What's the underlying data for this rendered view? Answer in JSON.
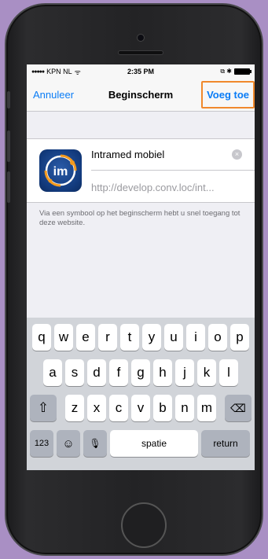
{
  "status": {
    "signal": "●●●●●",
    "carrier": "KPN NL",
    "wifi": "ᯤ",
    "time": "2:35 PM",
    "right_icons": "⧉ ✱"
  },
  "navbar": {
    "cancel_label": "Annuleer",
    "title": "Beginscherm",
    "add_label": "Voeg toe"
  },
  "bookmark": {
    "icon_text": "im",
    "name": "Intramed mobiel",
    "clear": "×",
    "url": "http://develop.conv.loc/int..."
  },
  "info_text": "Via een symbool op het beginscherm hebt u snel toegang tot deze website.",
  "keyboard": {
    "row1": [
      "q",
      "w",
      "e",
      "r",
      "t",
      "y",
      "u",
      "i",
      "o",
      "p"
    ],
    "row2": [
      "a",
      "s",
      "d",
      "f",
      "g",
      "h",
      "j",
      "k",
      "l"
    ],
    "row3": [
      "z",
      "x",
      "c",
      "v",
      "b",
      "n",
      "m"
    ],
    "shift": "⇧",
    "backspace": "⌫",
    "numbers": "123",
    "emoji": "☺",
    "mic": "🎙",
    "space": "spatie",
    "return": "return"
  },
  "colors": {
    "accent": "#0a7cf6",
    "highlight": "#f0892c",
    "background": "#a98fc4"
  }
}
